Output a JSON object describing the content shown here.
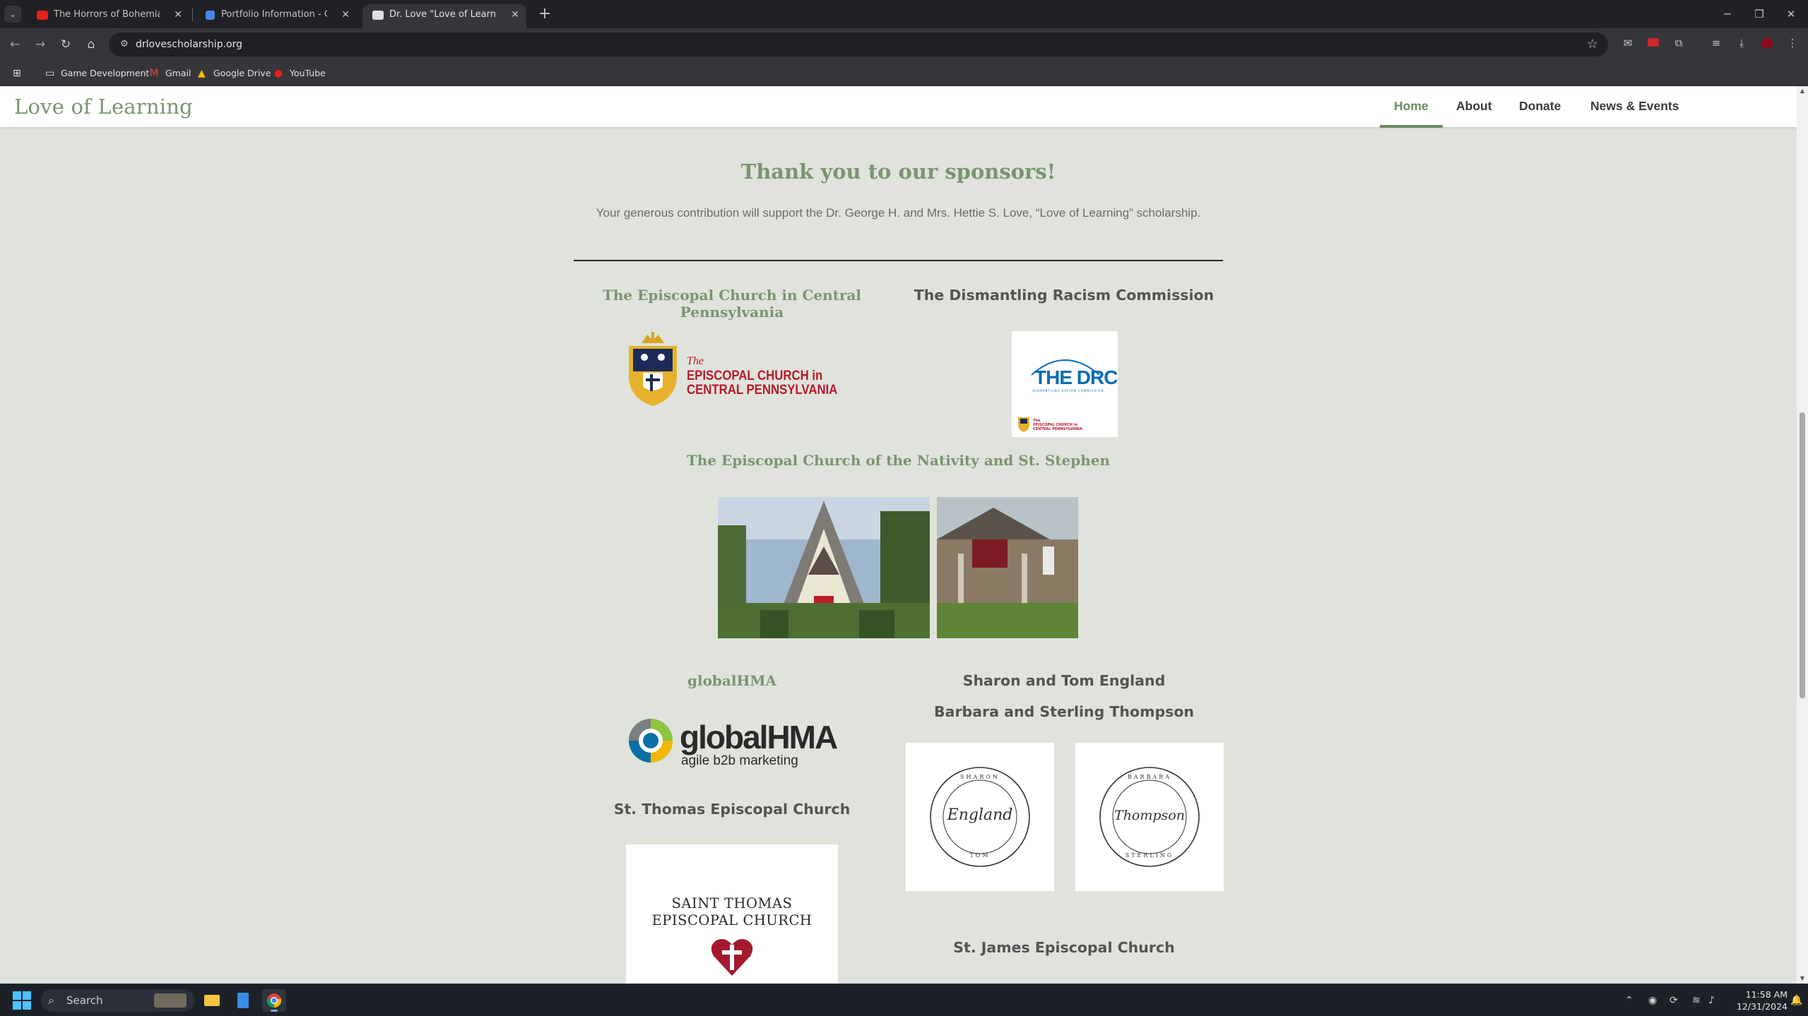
{
  "browser": {
    "tabs": [
      {
        "title": "The Horrors of Bohemian Grov",
        "active": false,
        "icon": "youtube-icon"
      },
      {
        "title": "Portfolio Information - Google",
        "active": false,
        "icon": "google-docs-icon"
      },
      {
        "title": "Dr. Love \"Love of Learning\" Sch",
        "active": true,
        "icon": "site-favicon-icon"
      }
    ],
    "url": "drlovescholarship.org",
    "bookmarks": [
      {
        "label": "Game Development",
        "icon": "folder-icon"
      },
      {
        "label": "Gmail",
        "icon": "gmail-icon"
      },
      {
        "label": "Google Drive",
        "icon": "google-drive-icon"
      },
      {
        "label": "YouTube",
        "icon": "youtube-icon"
      }
    ]
  },
  "site": {
    "logo": "Love of Learning",
    "nav": [
      {
        "label": "Home",
        "current": true
      },
      {
        "label": "About",
        "current": false
      },
      {
        "label": "Donate",
        "current": false
      },
      {
        "label": "News & Events",
        "current": false
      }
    ],
    "accent_color": "#7b9471",
    "background_color": "#dfe3dc"
  },
  "sponsors": {
    "heading": "Thank you to our sponsors!",
    "subtitle": "Your generous contribution will support the Dr. George H. and Mrs. Hettie S. Love, “Love of Learning” scholarship.",
    "names": {
      "episcopal_central_pa": "The Episcopal Church in Central Pennsylvania",
      "drc": "The Dismantling Racism Commission",
      "nativity": "The Episcopal Church of the Nativity and St. Stephen",
      "globalhma": "globalHMA",
      "england": "Sharon and Tom England",
      "thompson": "Barbara and Sterling Thompson",
      "st_thomas": "St. Thomas Episcopal Church",
      "st_james": "St. James Episcopal Church"
    },
    "logos": {
      "ecp_the": "The",
      "ecp_line1": "EPISCOPAL CHURCH in",
      "ecp_line2": "CENTRAL PENNSYLVANIA",
      "drc_word": "THE DRC",
      "drc_sub": "DISMANTLING RACISM COMMISSION",
      "drc_mini1": "The",
      "drc_mini2": "EPISCOPAL CHURCH in",
      "drc_mini3": "CENTRAL PENNSYLVANIA",
      "ghma_word": "globalHMA",
      "ghma_tag": "agile b2b marketing",
      "england_top": "SHARON",
      "england_script": "England",
      "england_bottom": "TOM",
      "thompson_top": "BARBARA",
      "thompson_script": "Thompson",
      "thompson_bottom": "STERLING",
      "st_thomas_line1": "SAINT THOMAS",
      "st_thomas_line2": "EPISCOPAL CHURCH"
    }
  },
  "taskbar": {
    "search_label": "Search",
    "time": "11:58 AM",
    "date": "12/31/2024"
  }
}
